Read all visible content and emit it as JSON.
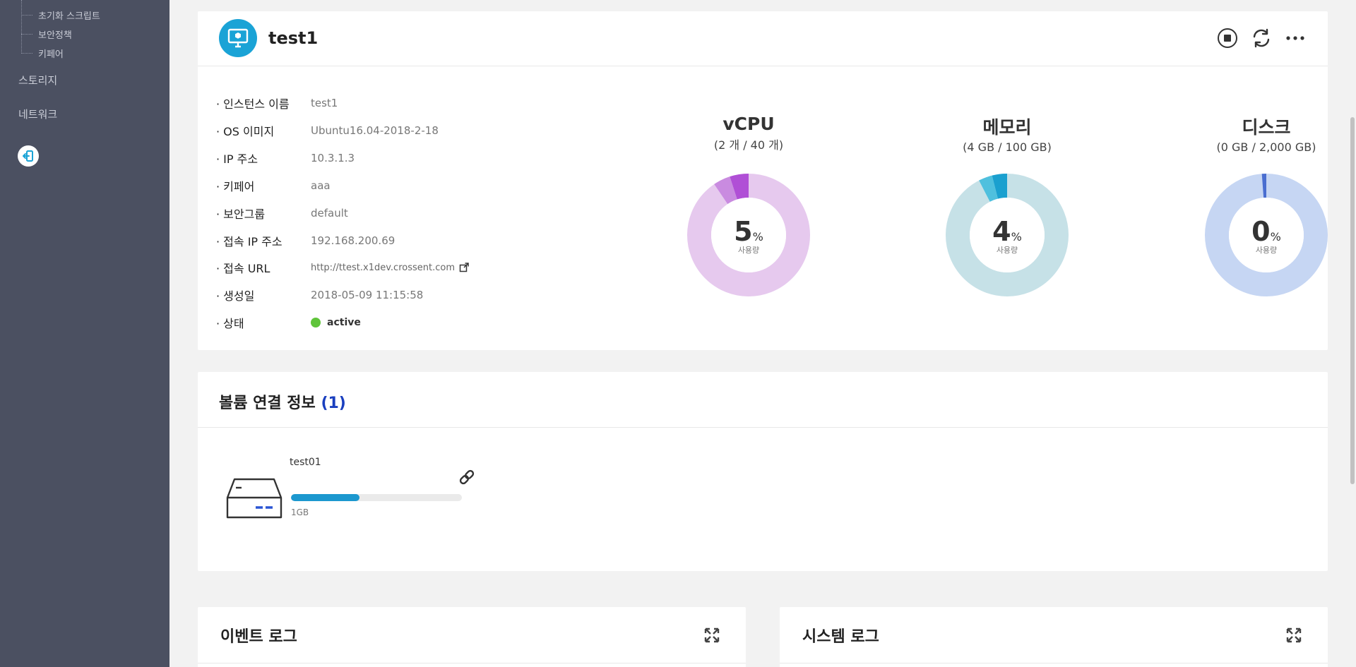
{
  "sidebar": {
    "tree_items": [
      "초기화 스크립트",
      "보안정책",
      "키페어"
    ],
    "nav_items": [
      "스토리지",
      "네트워크"
    ]
  },
  "instance": {
    "title": "test1",
    "info": [
      {
        "label": "· 인스턴스 이름",
        "value": "test1"
      },
      {
        "label": "· OS 이미지",
        "value": "Ubuntu16.04-2018-2-18"
      },
      {
        "label": "· IP 주소",
        "value": "10.3.1.3"
      },
      {
        "label": "· 키페어",
        "value": "aaa"
      },
      {
        "label": "· 보안그룹",
        "value": "default"
      },
      {
        "label": "· 접속 IP 주소",
        "value": "192.168.200.69"
      },
      {
        "label": "· 접속 URL",
        "value": "http://ttest.x1dev.crossent.com"
      },
      {
        "label": "· 생성일",
        "value": "2018-05-09 11:15:58"
      },
      {
        "label": "· 상태",
        "value": "active"
      }
    ],
    "gauges": [
      {
        "title": "vCPU",
        "sub": "(2 개 / 40 개)",
        "num": "5",
        "pct": "%",
        "usage": "사용량",
        "used_fraction": 0.05,
        "colors": {
          "base": "#e6c9ee",
          "used": "#c98be0",
          "accent": "#b04fd6"
        }
      },
      {
        "title": "메모리",
        "sub": "(4 GB / 100 GB)",
        "num": "4",
        "pct": "%",
        "usage": "사용량",
        "used_fraction": 0.04,
        "colors": {
          "base": "#c6e1e7",
          "used": "#4fc0de",
          "accent": "#1aa0cf"
        }
      },
      {
        "title": "디스크",
        "sub": "(0 GB / 2,000 GB)",
        "num": "0",
        "pct": "%",
        "usage": "사용량",
        "used_fraction": 0.0,
        "colors": {
          "base": "#c6d6f3",
          "used": "#6a8fdc",
          "accent": "#4a6ed0"
        }
      }
    ]
  },
  "volume": {
    "title": "볼륨 연결 정보",
    "count": "(1)",
    "item": {
      "name": "test01",
      "size": "1GB",
      "fill_fraction": 0.4
    }
  },
  "logs": {
    "event": "이벤트 로그",
    "system": "시스템 로그"
  },
  "icons": {
    "stop": "stop-icon",
    "refresh": "refresh-icon",
    "more": "more-icon",
    "link": "link-icon",
    "expand": "expand-icon",
    "logout": "logout-icon"
  },
  "colors": {
    "accent": "#1aa3d6",
    "status_active": "#5fc43a",
    "sidebar_bg": "#4b5061"
  }
}
